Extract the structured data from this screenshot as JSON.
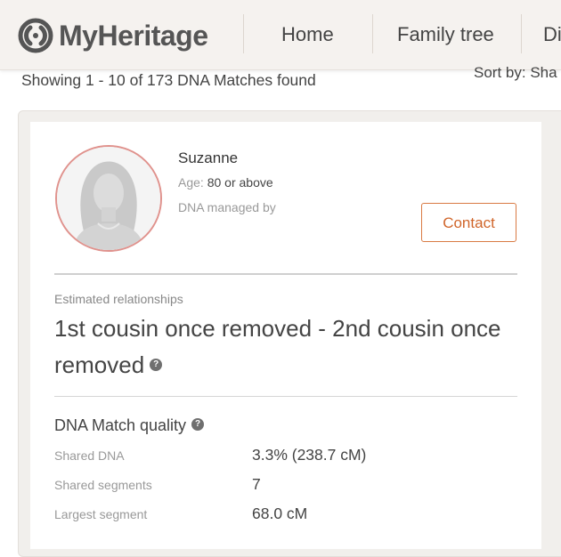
{
  "header": {
    "logo_text": "MyHeritage",
    "nav": [
      {
        "label": "Home"
      },
      {
        "label": "Family tree"
      },
      {
        "label": "Di"
      }
    ]
  },
  "results": {
    "showing_text": "Showing 1 - 10 of 173 DNA Matches found",
    "sort_label": "Sort by:",
    "sort_value": "Sha"
  },
  "match": {
    "name": "Suzanne",
    "age_label": "Age:",
    "age_value": "80 or above",
    "dna_managed_label": "DNA managed by",
    "contact_label": "Contact",
    "estimated_label": "Estimated relationships",
    "relationship": "1st cousin once removed - 2nd cousin once removed",
    "quality_title": "DNA Match quality",
    "stats": [
      {
        "label": "Shared DNA",
        "value": "3.3% (238.7 cM)"
      },
      {
        "label": "Shared segments",
        "value": "7"
      },
      {
        "label": "Largest segment",
        "value": "68.0 cM"
      }
    ]
  },
  "icons": {
    "help": "?"
  },
  "colors": {
    "accent": "#d0652a",
    "avatar_ring": "#e0928d"
  }
}
